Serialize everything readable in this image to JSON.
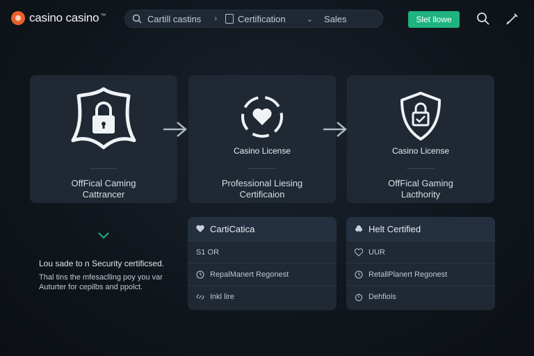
{
  "brand": {
    "name": "casino casino",
    "mark": "™"
  },
  "search": {
    "segment1": "Cartill castins",
    "segment2": "Certification",
    "segment3": "Sales"
  },
  "header": {
    "cta_label": "Slet llowe"
  },
  "steps": [
    {
      "mid_label": "",
      "caption_line1": "OffFical Caming",
      "caption_line2": "Cattrancer"
    },
    {
      "mid_label": "Casino License",
      "caption_line1": "Professional Liesing",
      "caption_line2": "Certificaion"
    },
    {
      "mid_label": "Casino License",
      "caption_line1": "OffFical Gaming",
      "caption_line2": "Lacthority"
    }
  ],
  "security": {
    "line1": "Lou sade to n Security certificsed.",
    "line2": "Thal tins the mfesaclling poy you var",
    "line3": "Auturter for cepilbs and ppolct."
  },
  "panels": [
    {
      "title": "CartiCatica",
      "rows": [
        "S1 OR",
        "RepalManert Regonest",
        "Inkl lire"
      ]
    },
    {
      "title": "Helt Certified",
      "rows": [
        "UUR",
        "RetallPlanert Regonest",
        "Dehfiols"
      ]
    }
  ],
  "colors": {
    "accent": "#1fb37f",
    "brand": "#e5632b",
    "card": "#1f2833",
    "background": "#10151c"
  }
}
